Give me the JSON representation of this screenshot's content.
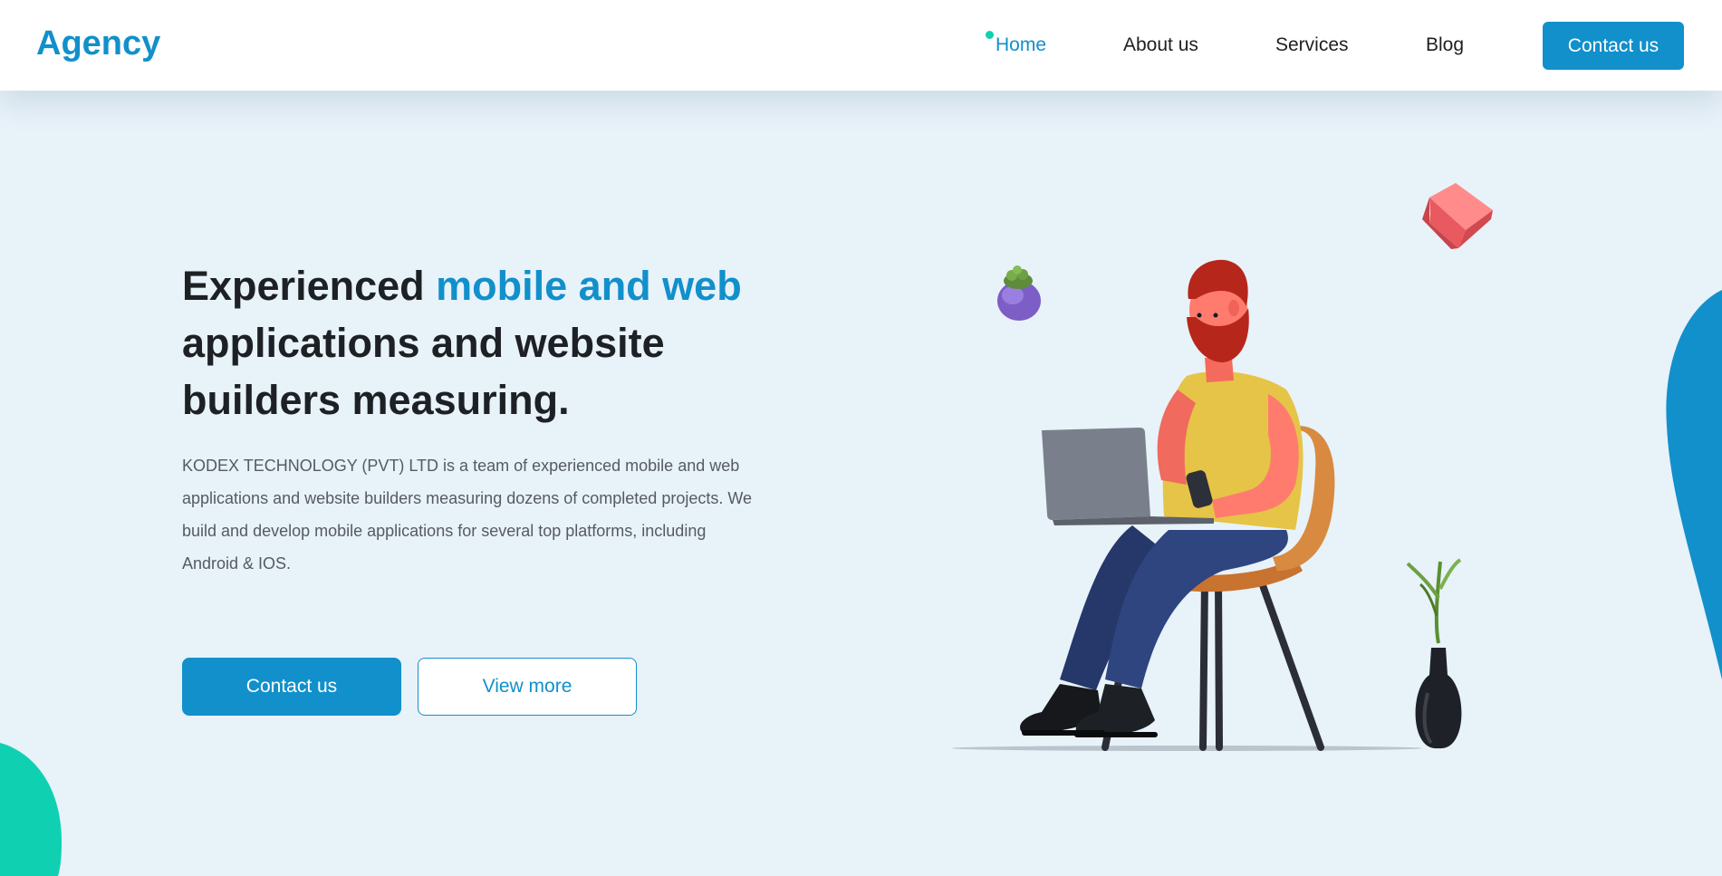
{
  "header": {
    "logo": "Agency",
    "nav": [
      {
        "label": "Home",
        "active": true
      },
      {
        "label": "About us",
        "active": false
      },
      {
        "label": "Services",
        "active": false
      },
      {
        "label": "Blog",
        "active": false
      }
    ],
    "contact_button": "Contact us"
  },
  "hero": {
    "title_part1": "Experienced ",
    "title_accent": "mobile and web",
    "title_part2": " applications and website builders measuring.",
    "description": "KODEX TECHNOLOGY (PVT) LTD is a team of experienced mobile and web applications and website builders measuring dozens of completed projects. We build and develop mobile applications for several top platforms, including Android & IOS.",
    "primary_button": "Contact us",
    "secondary_button": "View more"
  },
  "illustration": {
    "subject": "person-with-laptop-on-chair",
    "props": [
      "potted-cactus-icon",
      "red-block-icon",
      "vase-plant-icon"
    ]
  },
  "colors": {
    "accent": "#1190cb",
    "teal": "#0fd1b2",
    "background": "#e8f2f9",
    "heading": "#1d2125",
    "body_text": "#555b61"
  }
}
